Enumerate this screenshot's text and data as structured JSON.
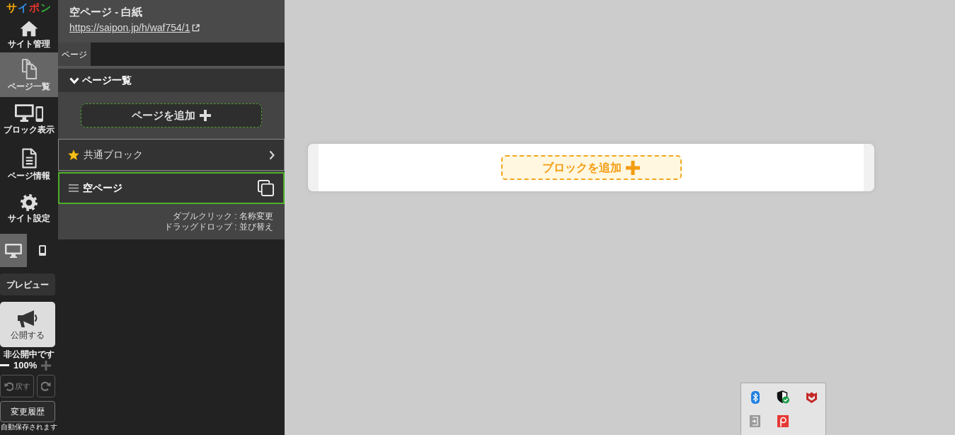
{
  "sidebar": {
    "logo": "サイポン",
    "nav": [
      {
        "kind": "site",
        "label": "サイト管理",
        "selected": false
      },
      {
        "kind": "pages",
        "label": "ページ一覧",
        "selected": true
      },
      {
        "kind": "blocks",
        "label": "ブロック表示",
        "selected": false
      },
      {
        "kind": "info",
        "label": "ページ情報",
        "selected": false
      },
      {
        "kind": "settings",
        "label": "サイト設定",
        "selected": false
      }
    ],
    "devices": [
      {
        "kind": "desktop",
        "selected": true
      },
      {
        "kind": "mobile",
        "selected": false
      }
    ],
    "preview_button": "プレビュー",
    "publish_button": "公開する",
    "publish_status": "非公開中です",
    "zoom": {
      "reading": "100%",
      "zoom_out_disabled": false,
      "zoom_in_disabled": true
    },
    "undo_button": {
      "label": "戻す",
      "disabled": true
    },
    "redo_button": {
      "disabled": true
    },
    "history_button": "変更履歴",
    "autosave_note": "自動保存されます"
  },
  "panel": {
    "title": "空ページ - 白紙",
    "url": "https://saipon.jp/h/waf754/1",
    "tabs": [
      {
        "label": "ページ",
        "selected": true
      }
    ],
    "section": {
      "title": "ページ一覧",
      "expanded": true
    },
    "add_page_button": "ページを追加",
    "items": [
      {
        "kind": "common",
        "label": "共通ブロック",
        "selected": false
      },
      {
        "kind": "page",
        "label": "空ページ",
        "selected": true
      }
    ],
    "hints": [
      "ダブルクリック : 名称変更",
      "ドラッグドロップ : 並び替え"
    ]
  },
  "canvas": {
    "add_block_button": "ブロックを追加"
  }
}
